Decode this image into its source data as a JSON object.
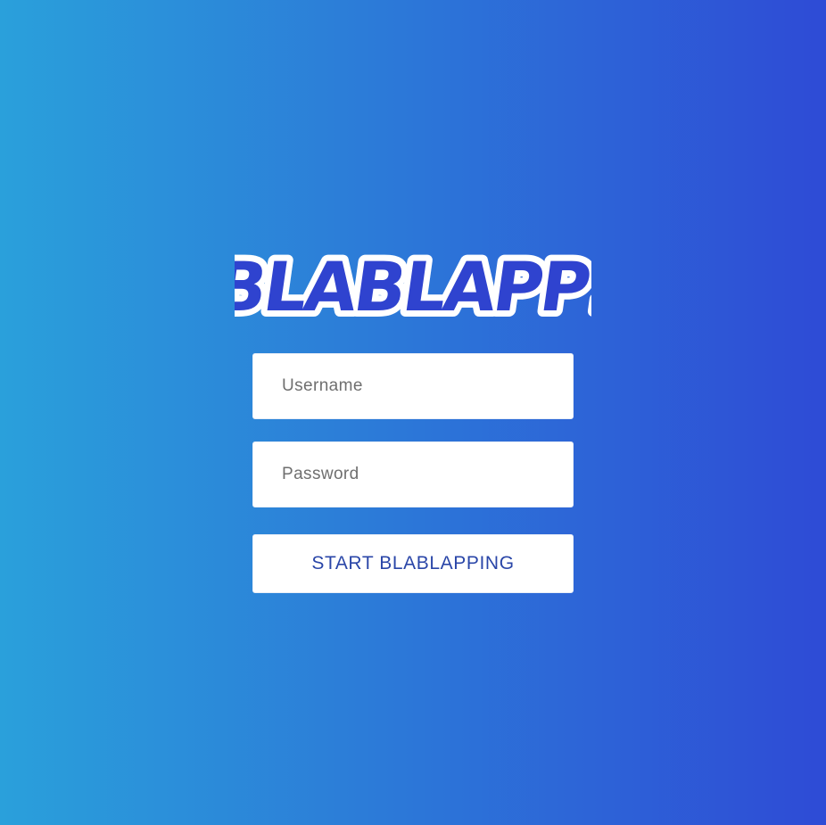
{
  "app": {
    "logo_text": "BLABLAPP!"
  },
  "login": {
    "username_placeholder": "Username",
    "password_placeholder": "Password",
    "submit_label": "START BLABLAPPING"
  },
  "colors": {
    "gradient_left": "#2aa0db",
    "gradient_right": "#2e4bd6",
    "logo_fill": "#2f43cf",
    "logo_outline": "#ffffff",
    "button_text": "#2a46a8"
  }
}
